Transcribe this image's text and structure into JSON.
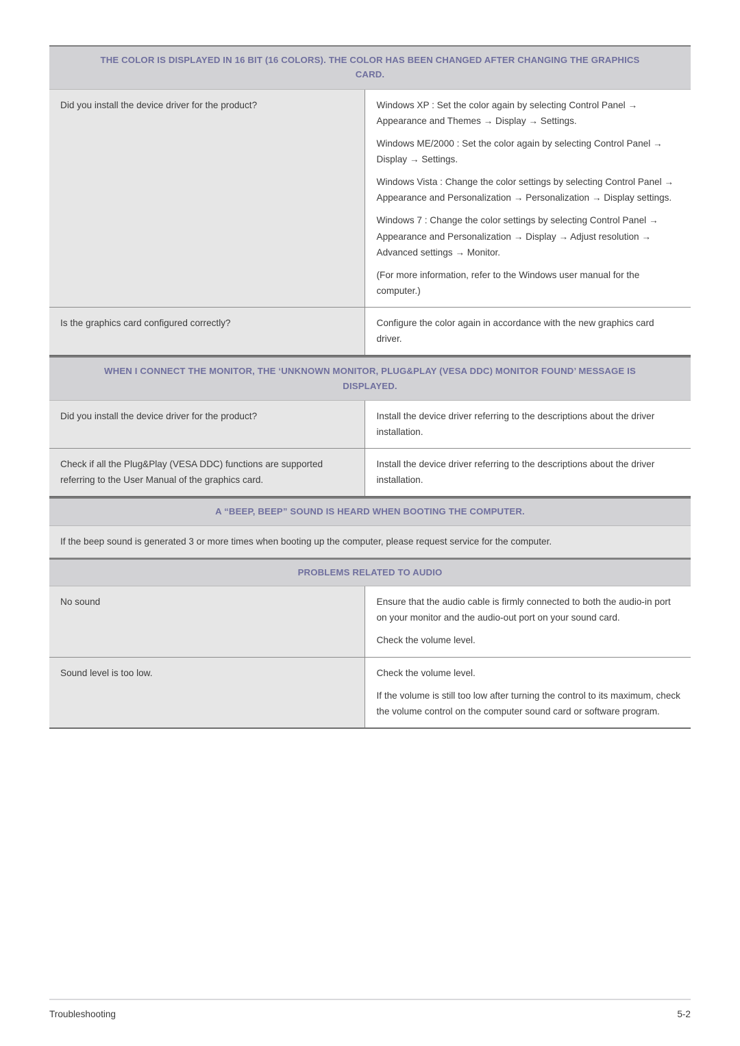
{
  "document": {
    "footer": {
      "section_label": "Troubleshooting",
      "page_number": "5-2"
    }
  },
  "sections": [
    {
      "heading": "THE COLOR IS DISPLAYED IN 16 BIT (16 COLORS). THE COLOR HAS BEEN CHANGED AFTER CHANGING THE GRAPHICS CARD.",
      "rows": [
        {
          "question": "Did you install the device driver for the product?",
          "answers": [
            "Windows XP : Set the color again by selecting Control Panel → Appearance and Themes → Display → Settings.",
            "Windows ME/2000 : Set the color again by selecting Control Panel → Display → Settings.",
            "Windows Vista : Change the color settings by selecting Control Panel → Appearance and Personalization → Personalization → Display settings.",
            "Windows 7 : Change the color settings by selecting Control Panel → Appearance and Personalization → Display → Adjust resolution → Advanced settings → Monitor.",
            "(For more information, refer to the Windows user manual for the computer.)"
          ]
        },
        {
          "question": "Is the graphics card configured correctly?",
          "answers": [
            "Configure the color again in accordance with the new graphics card driver."
          ]
        }
      ]
    },
    {
      "heading": "WHEN I CONNECT THE MONITOR, THE ‘UNKNOWN MONITOR, PLUG&PLAY (VESA DDC) MONITOR FOUND’ MESSAGE IS DISPLAYED.",
      "rows": [
        {
          "question": "Did you install the device driver for the product?",
          "answers": [
            "Install the device driver referring to the descriptions about the driver installation."
          ]
        },
        {
          "question": "Check if all the Plug&Play (VESA DDC) functions are supported referring to the User Manual of the graphics card.",
          "answers": [
            "Install the device driver referring to the descriptions about the driver installation."
          ]
        }
      ]
    },
    {
      "heading": "A “BEEP, BEEP” SOUND IS HEARD WHEN BOOTING THE COMPUTER.",
      "note": "If the beep sound is generated 3 or more times when booting up the computer, please request service for the computer.",
      "rows": []
    },
    {
      "heading": "PROBLEMS RELATED TO AUDIO",
      "rows": [
        {
          "question": "No sound",
          "answers": [
            "Ensure that the audio cable is firmly connected to both the audio-in port on your monitor and the audio-out port on your sound card.",
            "Check the volume level."
          ]
        },
        {
          "question": "Sound level is too low.",
          "answers": [
            "Check the volume level.",
            "If the volume is still too low after turning the control to its maximum, check the volume control on the computer sound card or software program."
          ]
        }
      ]
    }
  ]
}
